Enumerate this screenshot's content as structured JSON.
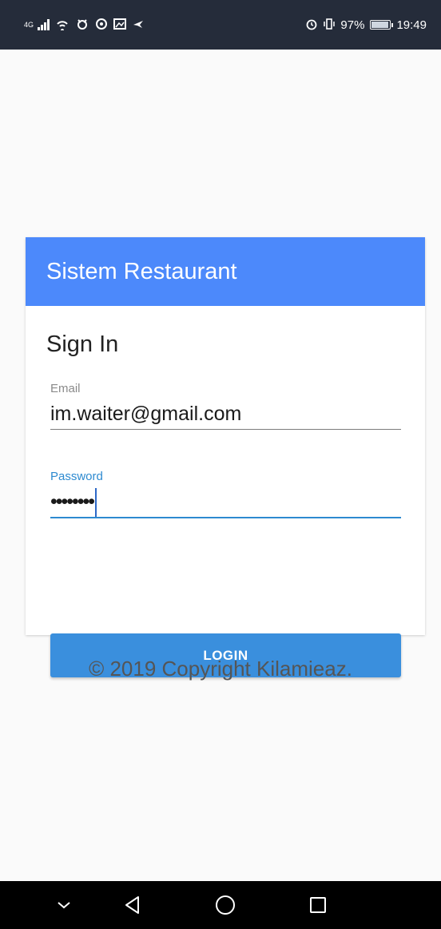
{
  "status_bar": {
    "network_type": "4G",
    "battery_percent": "97%",
    "time": "19:49",
    "icons": [
      "signal-icon",
      "wifi-icon",
      "notification-icon",
      "hotspot-icon",
      "gallery-icon",
      "bird-icon",
      "alarm-icon",
      "vibrate-icon",
      "battery-icon"
    ]
  },
  "card": {
    "header_title": "Sistem Restaurant",
    "heading": "Sign In",
    "email": {
      "label": "Email",
      "value": "im.waiter@gmail.com"
    },
    "password": {
      "label": "Password",
      "value": "••••••••"
    },
    "login_label": "LOGIN"
  },
  "footer": {
    "copyright": "© 2019 Copyright Kilamieaz."
  },
  "nav_bar": {
    "items": [
      "chevron-down-icon",
      "back-icon",
      "home-icon",
      "recents-icon"
    ]
  },
  "colors": {
    "header": "#4c89fb",
    "accent": "#2d8ad0",
    "button": "#3a8fdd",
    "status_bar": "#252c3a"
  }
}
